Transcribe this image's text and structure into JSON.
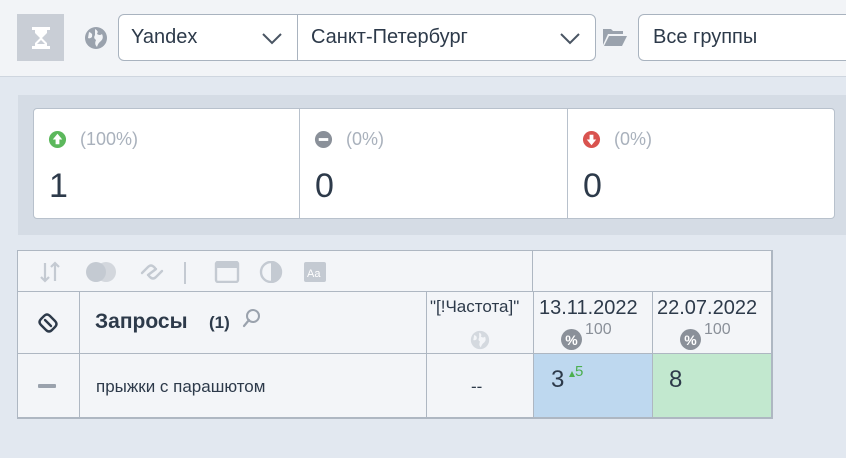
{
  "toolbar": {
    "engine": "Yandex",
    "region": "Санкт-Петербург",
    "groups": "Все группы"
  },
  "stats": {
    "up": {
      "percent": "(100%)",
      "value": "1",
      "color": "#5cb85c"
    },
    "same": {
      "percent": "(0%)",
      "value": "0",
      "color": "#8a9099"
    },
    "down": {
      "percent": "(0%)",
      "value": "0",
      "color": "#d9534f"
    }
  },
  "table": {
    "query_header": "Запросы",
    "query_count": "(1)",
    "freq_header": "\"[!Частота]\"",
    "dates": [
      {
        "label": "13.11.2022",
        "percent": "100"
      },
      {
        "label": "22.07.2022",
        "percent": "100"
      }
    ],
    "rows": [
      {
        "query": "прыжки с парашютом",
        "frequency": "--",
        "pos_1": "3",
        "pos_1_change": "5",
        "pos_2": "8"
      }
    ],
    "colors": {
      "pos_improved": "#bed8ef",
      "pos_top": "#c2e8cf"
    }
  }
}
